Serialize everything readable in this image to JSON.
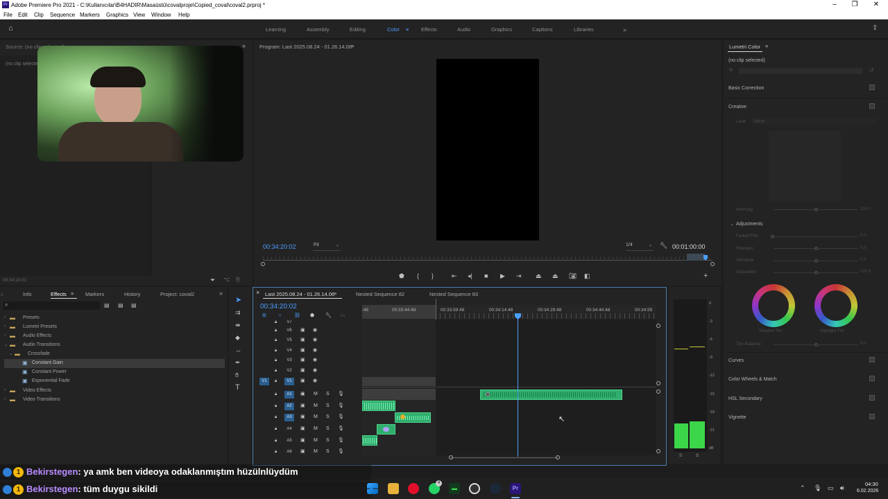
{
  "window": {
    "title": "Adobe Premiere Pro 2021 - C:\\Kullanıcılar\\B4HADIR\\Masaüstü\\covalproje\\Copied_coval\\coval2.prproj *",
    "logo": "Pr"
  },
  "menu": [
    "File",
    "Edit",
    "Clip",
    "Sequence",
    "Markers",
    "Graphics",
    "View",
    "Window",
    "Help"
  ],
  "workspaces": [
    {
      "label": "Learning",
      "active": false
    },
    {
      "label": "Assembly",
      "active": false
    },
    {
      "label": "Editing",
      "active": false
    },
    {
      "label": "Color",
      "active": true
    },
    {
      "label": "Effects",
      "active": false
    },
    {
      "label": "Audio",
      "active": false
    },
    {
      "label": "Graphics",
      "active": false
    },
    {
      "label": "Captions",
      "active": false
    },
    {
      "label": "Libraries",
      "active": false
    }
  ],
  "source_panel": {
    "header": "Source: (no clip selected)",
    "body": "(no clip selected)",
    "timecode": "00:34:20:02"
  },
  "program_monitor": {
    "header": "Program: Last 2025.08.24 - 01.26.14.06",
    "timecode": "00:34:20:02",
    "zoom": "Fit",
    "resolution": "1/4",
    "duration": "00:01:00:00"
  },
  "project_panel": {
    "tabs": [
      {
        "label": "Info",
        "active": false
      },
      {
        "label": "Effects",
        "active": true
      },
      {
        "label": "Markers",
        "active": false
      },
      {
        "label": "History",
        "active": false
      },
      {
        "label": "Project: coval2",
        "active": false
      }
    ],
    "tree": [
      {
        "label": "Presets",
        "depth": 0,
        "type": "folder"
      },
      {
        "label": "Lumetri Presets",
        "depth": 0,
        "type": "folder"
      },
      {
        "label": "Audio Effects",
        "depth": 0,
        "type": "folder"
      },
      {
        "label": "Audio Transitions",
        "depth": 0,
        "type": "folder-open"
      },
      {
        "label": "Crossfade",
        "depth": 1,
        "type": "folder-open"
      },
      {
        "label": "Constant Gain",
        "depth": 2,
        "type": "item",
        "selected": true
      },
      {
        "label": "Constant Power",
        "depth": 2,
        "type": "item"
      },
      {
        "label": "Exponential Fade",
        "depth": 2,
        "type": "item"
      },
      {
        "label": "Video Effects",
        "depth": 0,
        "type": "folder"
      },
      {
        "label": "Video Transitions",
        "depth": 0,
        "type": "folder"
      }
    ]
  },
  "timeline": {
    "tabs": [
      {
        "label": "Last 2025.08.24 - 01.26.14.06",
        "active": true
      },
      {
        "label": "Nested Sequence 82",
        "active": false
      },
      {
        "label": "Nested Sequence 83",
        "active": false
      }
    ],
    "timecode": "00:34:20:02",
    "ruler": [
      ":48",
      "00:33:44:48",
      "00:33:59:48",
      "00:34:14:48",
      "00:34:29:48",
      "00:34:44:48",
      "00:34:59"
    ],
    "video_tracks": [
      "V7",
      "V6",
      "V5",
      "V4",
      "V3",
      "V2",
      "V1"
    ],
    "audio_tracks": [
      "A1",
      "A2",
      "A3",
      "A4",
      "A5",
      "A6"
    ],
    "mute_label": "M",
    "solo_label": "S",
    "source_patch": "V1"
  },
  "audio_meter": {
    "scale": [
      "0",
      "-3",
      "-6",
      "-9",
      "-12",
      "-15",
      "-18",
      "-21",
      "dB"
    ],
    "channels": [
      "S",
      "S"
    ]
  },
  "lumetri": {
    "header": "Lumetri Color",
    "clip": "(no clip selected)",
    "fx_label": "fx",
    "sections": {
      "basic": "Basic Correction",
      "creative": "Creative",
      "look_label": "Look",
      "look_value": "None",
      "intensity": "Intensity",
      "intensity_val": "100.0",
      "adjustments": "Adjustments",
      "sliders": [
        {
          "label": "Faded Film",
          "value": "0.0"
        },
        {
          "label": "Sharpen",
          "value": "0.0"
        },
        {
          "label": "Vibrance",
          "value": "0.0"
        },
        {
          "label": "Saturation",
          "value": "100.0"
        }
      ],
      "shadow_tint": "Shadow Tint",
      "highlight_tint": "Highlight Tint",
      "tint_balance": "Tint Balance",
      "tint_balance_val": "0.0",
      "curves": "Curves",
      "wheels": "Color Wheels & Match",
      "hsl": "HSL Secondary",
      "vignette": "Vignette"
    }
  },
  "chat": [
    {
      "user": "Bekirstegen",
      "message": ": ya amk ben videoya odaklanmıştım hüzülnlüydüm"
    },
    {
      "user": "Bekirstegen",
      "message": ": tüm duygu sikildi"
    }
  ],
  "taskbar": {
    "time": "04:30",
    "date": "6.02.2026",
    "whatsapp_badge": "4",
    "pr_label": "Pr"
  },
  "colors": {
    "accent": "#4a9eff",
    "clip_green": "#2fae6d",
    "meter_green": "#3cd64a",
    "chat_user": "#b88cff"
  }
}
